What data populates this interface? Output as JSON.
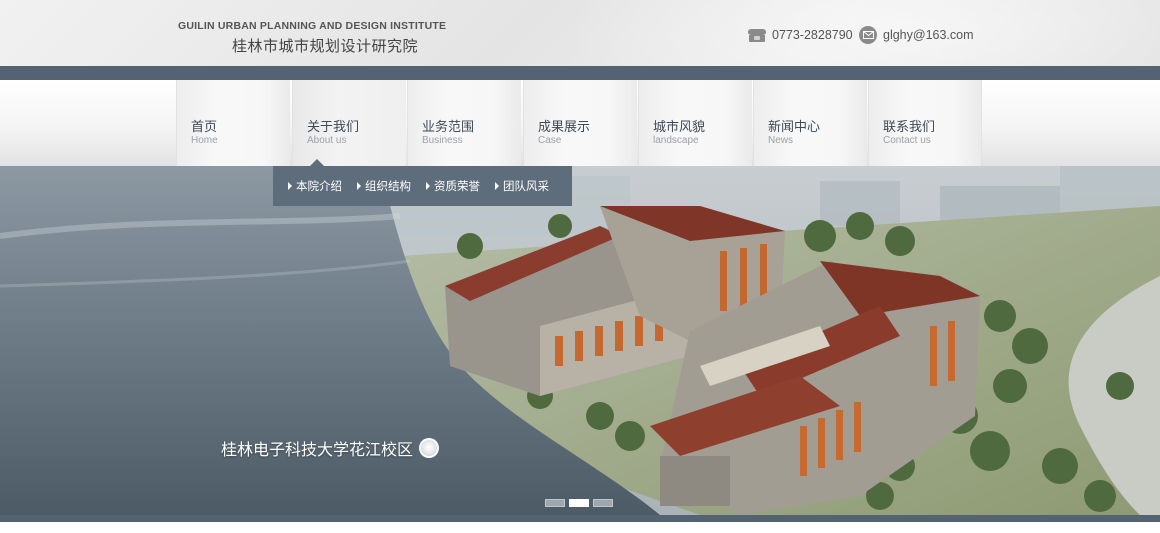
{
  "header": {
    "institute_en": "GUILIN URBAN PLANNING AND DESIGN INSTITUTE",
    "institute_cn": "桂林市城市规划设计研究院",
    "phone": "0773-2828790",
    "phone_icon": "telephone-icon",
    "email": "glghy@163.com",
    "email_icon": "envelope-icon"
  },
  "nav": {
    "items": [
      {
        "cn": "首页",
        "en": "Home"
      },
      {
        "cn": "关于我们",
        "en": "About us"
      },
      {
        "cn": "业务范围",
        "en": "Business"
      },
      {
        "cn": "成果展示",
        "en": "Case"
      },
      {
        "cn": "城市风貌",
        "en": "landscape"
      },
      {
        "cn": "新闻中心",
        "en": "News"
      },
      {
        "cn": "联系我们",
        "en": "Contact us"
      }
    ],
    "active_index": 1
  },
  "submenu": {
    "items": [
      "本院介绍",
      "组织结构",
      "资质荣誉",
      "团队风采"
    ]
  },
  "hero": {
    "caption": "桂林电子科技大学花江校区",
    "slide_count": 3,
    "active_slide": 2
  },
  "colors": {
    "accent_bar": "#546372",
    "submenu_bg": "#5e6d7b",
    "nav_text": "#3e4a56"
  }
}
